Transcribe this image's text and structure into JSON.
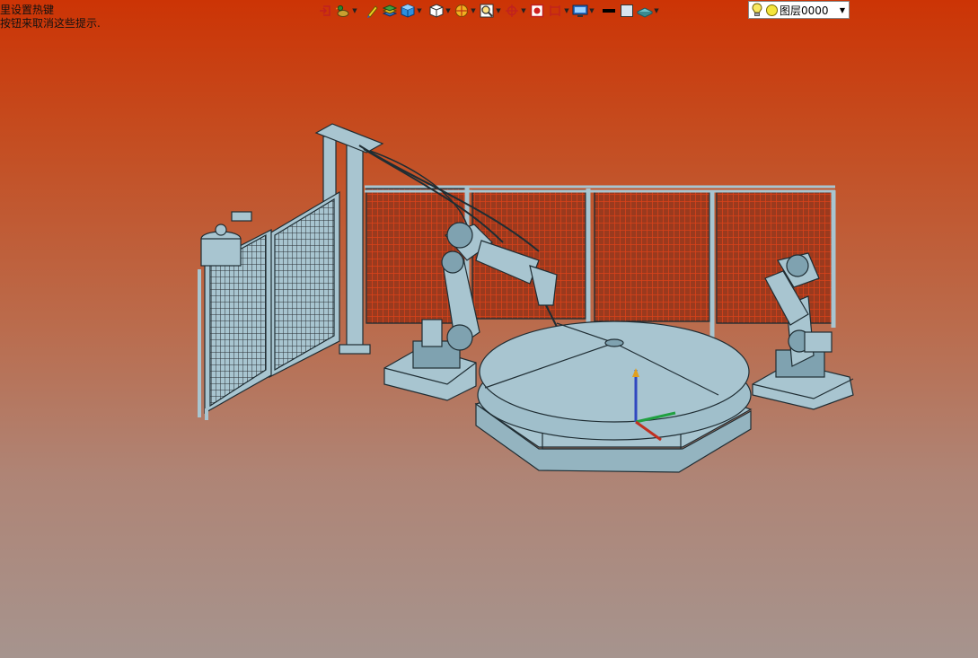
{
  "hints": {
    "line1": "里设置热键",
    "line2": "按钮来取消这些提示."
  },
  "toolbar": {
    "items": [
      {
        "icon": "exit-view-icon",
        "has_dropdown": false
      },
      {
        "icon": "duck-icon",
        "has_dropdown": true
      },
      {
        "icon": "pencil-icon",
        "has_dropdown": false
      },
      {
        "icon": "layers-stack-icon",
        "has_dropdown": false
      },
      {
        "icon": "cube-shaded-icon",
        "has_dropdown": true
      },
      {
        "icon": "cube-view-icon",
        "has_dropdown": true
      },
      {
        "icon": "render-mode-icon",
        "has_dropdown": true
      },
      {
        "icon": "zoom-icon",
        "has_dropdown": true
      },
      {
        "icon": "origin-icon",
        "has_dropdown": true
      },
      {
        "icon": "record-icon",
        "has_dropdown": false
      },
      {
        "icon": "dimension-icon",
        "has_dropdown": true
      },
      {
        "icon": "display-icon",
        "has_dropdown": true
      },
      {
        "icon": "line-color-icon",
        "has_dropdown": false
      },
      {
        "icon": "fill-color-icon",
        "has_dropdown": false
      },
      {
        "icon": "surface-color-icon",
        "has_dropdown": true
      }
    ]
  },
  "layer": {
    "value": "图层0000"
  },
  "colors": {
    "model": "#a8c5d0",
    "model_dark": "#7fa2b0",
    "edge": "#1f2d33",
    "fence_mesh": "#c23a14"
  }
}
